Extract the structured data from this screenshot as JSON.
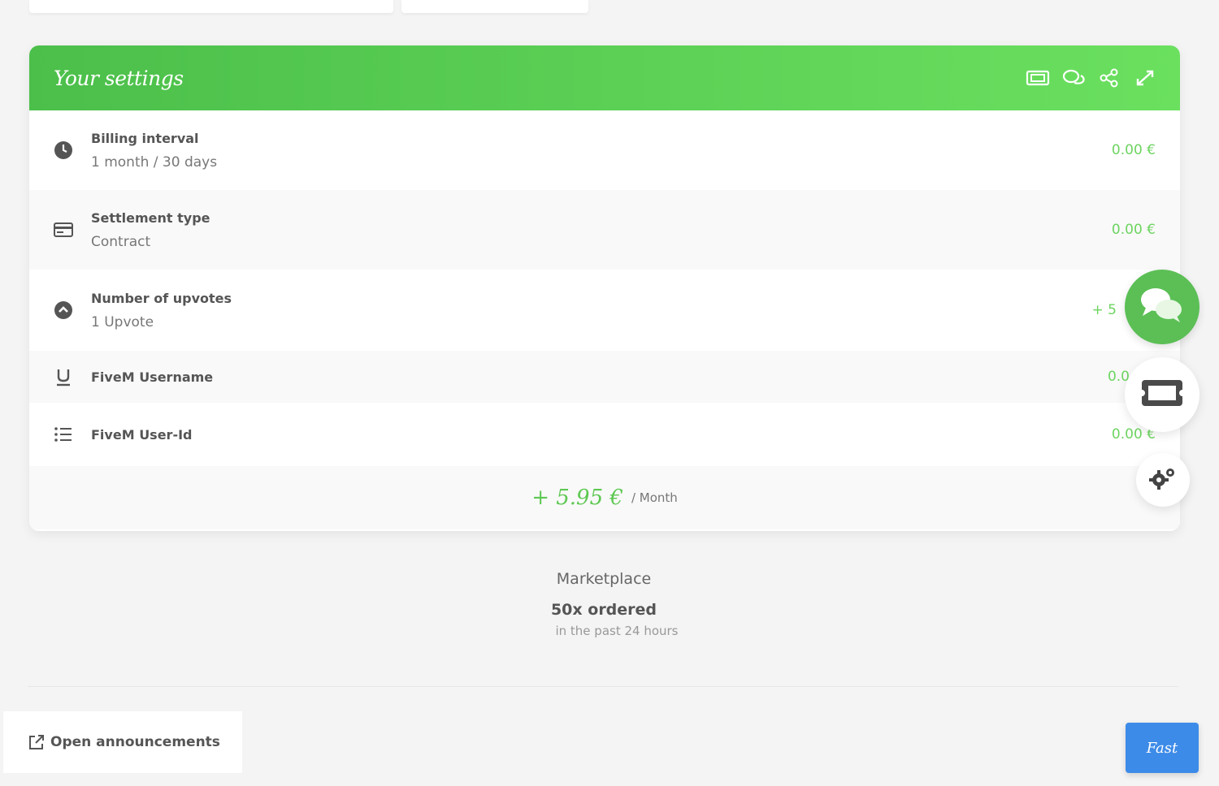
{
  "colors": {
    "header_gradient_start": "#4bbf4a",
    "header_gradient_end": "#6be05f",
    "price_green": "#6dd460",
    "fab_green": "#5bbf55",
    "fast_button": "#3d8be8"
  },
  "settings": {
    "title": "Your settings",
    "header_icons": [
      "ticket-icon",
      "chat-icon",
      "share-icon",
      "expand-icon"
    ],
    "rows": [
      {
        "icon": "clock-icon",
        "label": "Billing interval",
        "value": "1 month / 30 days",
        "price": "0.00 €"
      },
      {
        "icon": "credit-card-icon",
        "label": "Settlement type",
        "value": "Contract",
        "price": "0.00 €"
      },
      {
        "icon": "chevron-up-circle-icon",
        "label": "Number of upvotes",
        "value": "1 Upvote",
        "price": "+ 5"
      },
      {
        "icon": "underline-icon",
        "label": "FiveM Username",
        "value": "",
        "price": "0.0"
      },
      {
        "icon": "list-icon",
        "label": "FiveM User-Id",
        "value": "",
        "price": "0.00 €"
      }
    ],
    "total": {
      "amount": "+ 5.95 €",
      "period": "/ Month"
    }
  },
  "marketplace": {
    "title": "Marketplace",
    "count": "50x ordered",
    "subtitle": "in the past 24 hours"
  },
  "footer": {
    "announcements_label": "Open announcements",
    "fast_label": "Fast"
  },
  "floating": [
    "chat-icon",
    "ticket-icon",
    "gears-icon"
  ]
}
